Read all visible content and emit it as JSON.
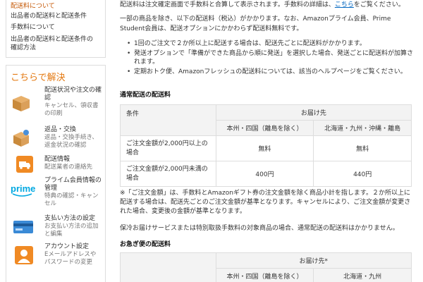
{
  "sidebar": {
    "links": [
      "配送料について",
      "出品者の配送料と配送条件",
      "手数料について",
      "出品者の配送料と配送条件の",
      "確認方法"
    ],
    "help_title": "こちらで解決",
    "help_items": [
      {
        "icon": "box-icon",
        "title": "配送状況や注文の確\n認",
        "sub": "キャンセル、領収書\nの印刷"
      },
      {
        "icon": "return-box-icon",
        "title": "返品・交換",
        "sub": "返品・交換手続き、\n返金状況の確認"
      },
      {
        "icon": "truck-icon",
        "title": "配送情報",
        "sub": "配送業者の連絡先"
      },
      {
        "icon": "prime-logo-icon",
        "title": "プライム会員情報の\n管理",
        "sub": "特典の確認・キャン\nセル"
      },
      {
        "icon": "credit-card-icon",
        "title": "支払い方法の設定",
        "sub": "お支払い方法の追加\nと編集"
      },
      {
        "icon": "person-icon",
        "title": "アカウント設定",
        "sub": "Eメールアドレスや\nパスワードの変更"
      }
    ]
  },
  "main": {
    "intro_before_link": "配送料は注文確定画面で手数料と合算して表示されます。手数料の詳細は、",
    "intro_link": "こちら",
    "intro_after_link": "をご覧ください。",
    "paragraph1": "一部の商品を除き、以下の配送料（税込）がかかります。なお、Amazonプライム会員、Prime Student会員は、配送オプションにかかわらず配送料無料です。",
    "bullets": [
      "1回のご注文で２か所以上に配送する場合は、配送先ごとに配送料がかかります。",
      "発送オプションで「準備ができた商品から順に発送」を選択した場合、発送ごとに配送料が加算されます。",
      "定期おトク便、Amazonフレッシュの配送料については、該当のヘルプページをご覧ください。"
    ],
    "normal_heading": "通常配送の配送料",
    "normal_table": {
      "condition_header": "条件",
      "dest_header": "お届け先",
      "region1": "本州・四国（離島を除く）",
      "region2": "北海道・九州・沖縄・離島",
      "rows": [
        {
          "condition": "ご注文金額が2,000円以上の場合",
          "v1": "無料",
          "v2": "無料"
        },
        {
          "condition": "ご注文金額が2,000円未満の場合",
          "v1": "400円",
          "v2": "440円"
        }
      ]
    },
    "note1": "※「ご注文金額」は、手数料とAmazonギフト券の注文金額を除く商品小計を指します。２か所以上に配送する場合は、配送先ごとのご注文金額が基準となります。キャンセルにより、ご注文金額が変更された場合、変更後の金額が基準となります。",
    "note2": "保冷お届けサービスまたは特別取扱手数料の対象商品の場合、通常配送の配送料はかかりません。",
    "express_heading": "お急ぎ便の配送料",
    "express_table": {
      "dest_header": "お届け先*",
      "region1": "本州・四国（離島を除く）",
      "region2": "北海道・九州"
    }
  },
  "colors": {
    "accent_orange": "#e47911",
    "active_link": "#c45500",
    "link_blue": "#0066c0",
    "prime_blue": "#00a8e1"
  }
}
